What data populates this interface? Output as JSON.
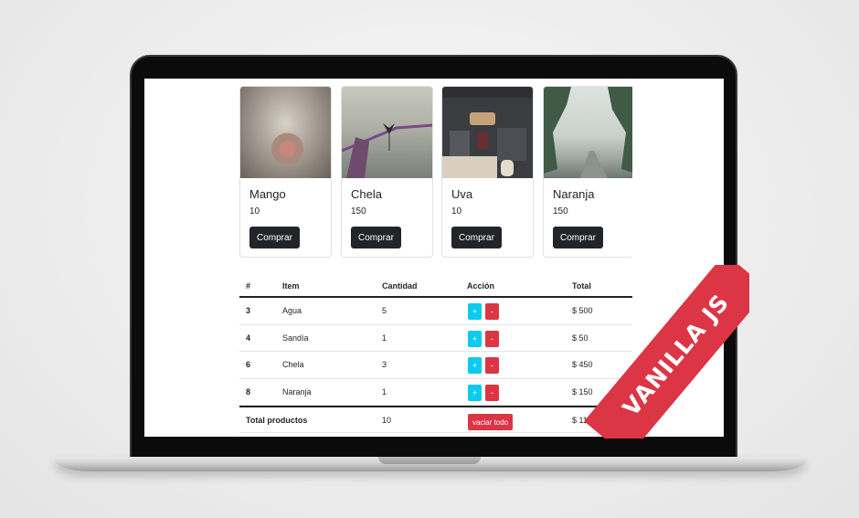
{
  "products": [
    {
      "name": "Mango",
      "price": "10",
      "button": "Comprar"
    },
    {
      "name": "Chela",
      "price": "150",
      "button": "Comprar"
    },
    {
      "name": "Uva",
      "price": "10",
      "button": "Comprar"
    },
    {
      "name": "Naranja",
      "price": "150",
      "button": "Comprar"
    }
  ],
  "cart": {
    "headers": [
      "#",
      "Item",
      "Cantidad",
      "Acción",
      "Total"
    ],
    "rows": [
      {
        "id": "3",
        "item": "Agua",
        "qty": "5",
        "plus": "+",
        "minus": "-",
        "total": "$ 500"
      },
      {
        "id": "4",
        "item": "Sandía",
        "qty": "1",
        "plus": "+",
        "minus": "-",
        "total": "$ 50"
      },
      {
        "id": "6",
        "item": "Chela",
        "qty": "3",
        "plus": "+",
        "minus": "-",
        "total": "$ 450"
      },
      {
        "id": "8",
        "item": "Naranja",
        "qty": "1",
        "plus": "+",
        "minus": "-",
        "total": "$ 150"
      }
    ],
    "footer": {
      "label": "Total productos",
      "qty": "10",
      "clear_button": "vaciar todo",
      "total": "$ 11"
    }
  },
  "ribbon": {
    "text": "VANILLA JS"
  },
  "colors": {
    "accent": "#dc3545",
    "info": "#0dcaf0",
    "dark": "#212529"
  }
}
